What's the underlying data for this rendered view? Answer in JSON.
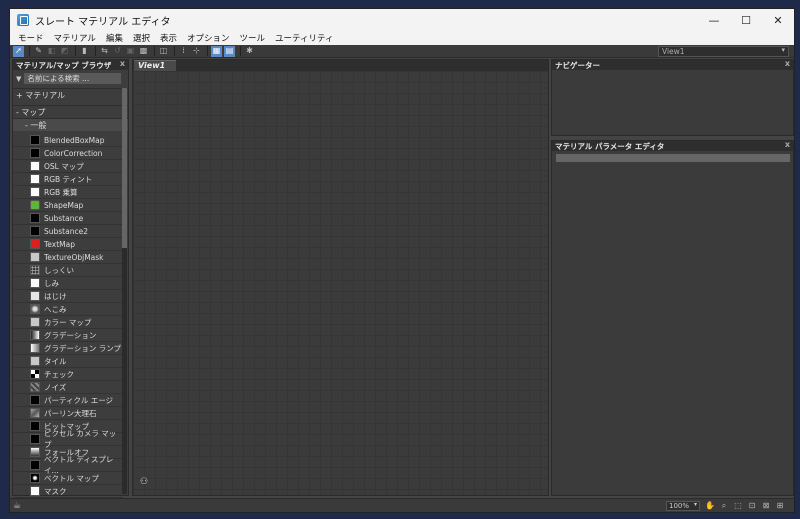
{
  "window": {
    "title": "スレート マテリアル エディタ",
    "controls": {
      "minimize": "—",
      "maximize": "☐",
      "close": "✕"
    }
  },
  "menu": [
    "モード",
    "マテリアル",
    "編集",
    "選択",
    "表示",
    "オプション",
    "ツール",
    "ユーティリティ"
  ],
  "toolbar": {
    "view_select": "View1"
  },
  "browser": {
    "title": "マテリアル/マップ ブラウザ",
    "search_placeholder": "名前による検索 ...",
    "groups": {
      "materials": "+ マテリアル",
      "maps": "- マップ",
      "general": "- 一般"
    },
    "maps": [
      {
        "name": "BlendedBoxMap",
        "swatch": "black"
      },
      {
        "name": "ColorCorrection",
        "swatch": "black"
      },
      {
        "name": "OSL マップ",
        "swatch": "white"
      },
      {
        "name": "RGB ティント",
        "swatch": "white"
      },
      {
        "name": "RGB 乗算",
        "swatch": "white"
      },
      {
        "name": "ShapeMap",
        "swatch": "green"
      },
      {
        "name": "Substance",
        "swatch": "black"
      },
      {
        "name": "Substance2",
        "swatch": "black"
      },
      {
        "name": "TextMap",
        "swatch": "red"
      },
      {
        "name": "TextureObjMask",
        "swatch": "grey"
      },
      {
        "name": "しっくい",
        "swatch": "dots"
      },
      {
        "name": "しみ",
        "swatch": "white"
      },
      {
        "name": "はじけ",
        "swatch": "lgrey"
      },
      {
        "name": "へこみ",
        "swatch": "dent"
      },
      {
        "name": "カラー マップ",
        "swatch": "grey"
      },
      {
        "name": "グラデーション",
        "swatch": "gradient"
      },
      {
        "name": "グラデーション ランプ",
        "swatch": "ramp"
      },
      {
        "name": "タイル",
        "swatch": "grey"
      },
      {
        "name": "チェック",
        "swatch": "check"
      },
      {
        "name": "ノイズ",
        "swatch": "noise"
      },
      {
        "name": "パーティクル エージ",
        "swatch": "black"
      },
      {
        "name": "パーリン大理石",
        "swatch": "marble"
      },
      {
        "name": "ビットマップ",
        "swatch": "black"
      },
      {
        "name": "ピクセル カメラ マップ",
        "swatch": "black"
      },
      {
        "name": "フォールオフ",
        "swatch": "falloff"
      },
      {
        "name": "ベクトル ディスプレイ...",
        "swatch": "black"
      },
      {
        "name": "ベクトル マップ",
        "swatch": "vector"
      },
      {
        "name": "マスク",
        "swatch": "white"
      }
    ]
  },
  "view": {
    "tab_label": "View1"
  },
  "navigator": {
    "title": "ナビゲーター"
  },
  "param_editor": {
    "title": "マテリアル パラメータ エディタ"
  },
  "status": {
    "zoom": "100%"
  },
  "colors": {
    "panel_bg": "#3b3b3b",
    "header_bg": "#2e2e2e",
    "accent": "#5a8ac6"
  }
}
